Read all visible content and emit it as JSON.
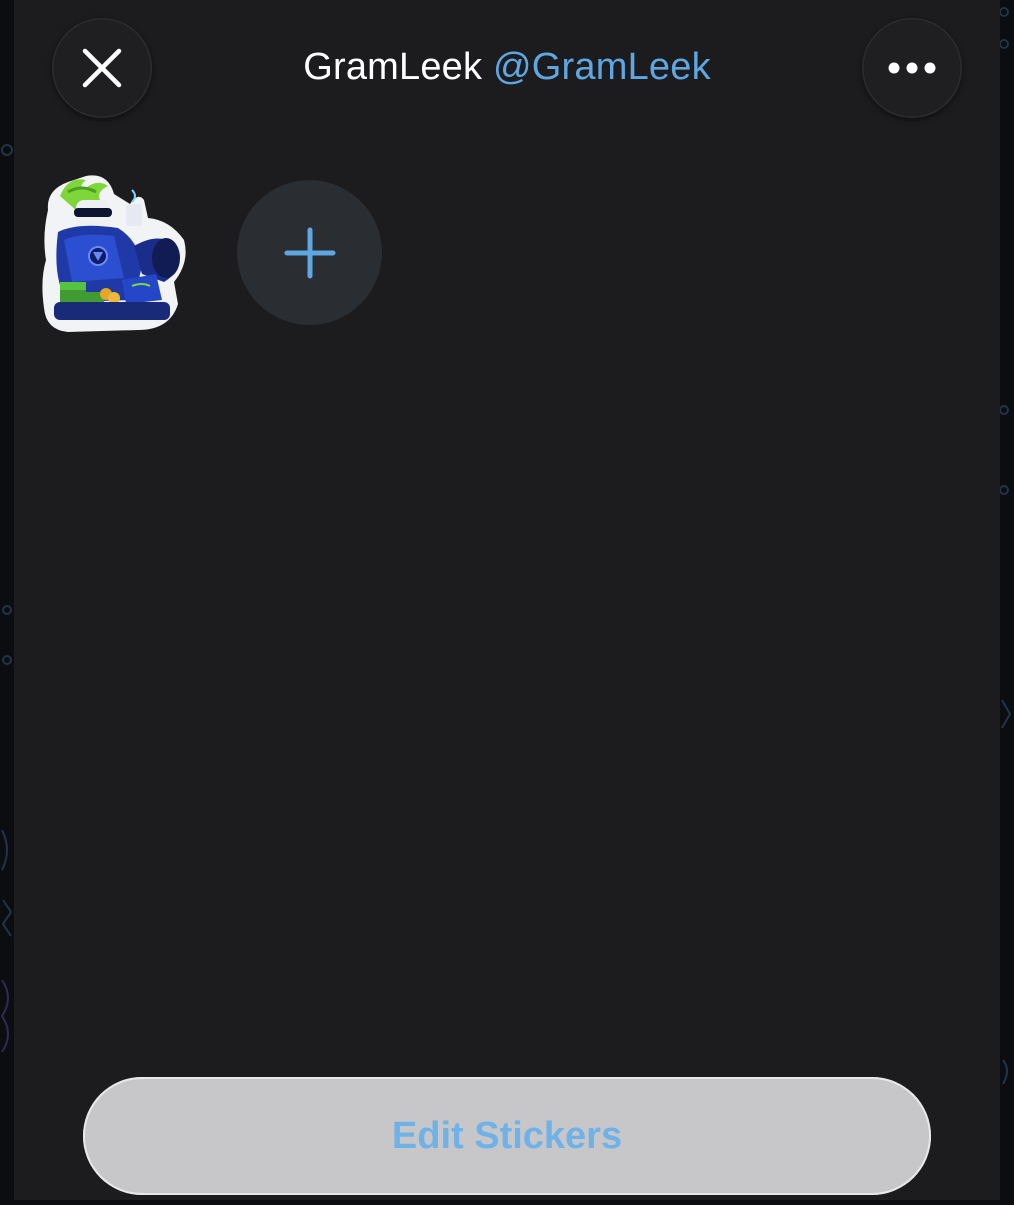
{
  "header": {
    "name": "GramLeek",
    "handle": "@GramLeek",
    "close_icon": "close-icon",
    "more_icon": "more-horizontal-icon"
  },
  "stickers": [
    {
      "icon": "leek-character-sticker"
    }
  ],
  "add_sticker_icon": "plus-icon",
  "footer": {
    "edit_label": "Edit Stickers"
  },
  "colors": {
    "sheet_background": "#1c1c1e",
    "accent": "#5fa7e3",
    "button_background": "#c7c7c9",
    "add_button_background": "#2a2d31"
  }
}
